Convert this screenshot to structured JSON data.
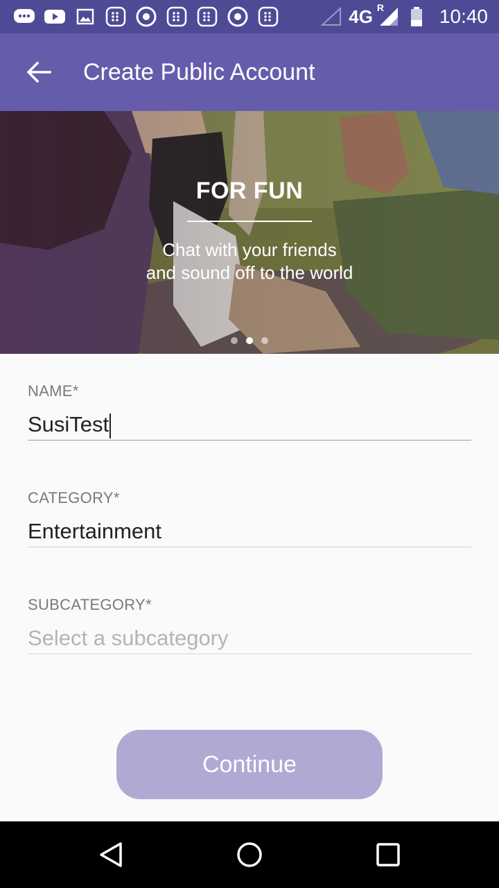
{
  "status_bar": {
    "network": "4G",
    "roaming": "R",
    "time": "10:40",
    "icons": [
      "messages-icon",
      "youtube-icon",
      "gallery-icon",
      "app-grid-icon",
      "chrome-icon",
      "app-grid-icon",
      "app-grid-icon",
      "chrome-icon",
      "app-grid-icon",
      "signal-icon",
      "battery-icon"
    ]
  },
  "app_bar": {
    "title": "Create Public Account",
    "back_icon": "arrow-back-icon"
  },
  "banner": {
    "title": "FOR FUN",
    "subtitle_line1": "Chat with your friends",
    "subtitle_line2": "and sound off to the world",
    "page_count": 3,
    "active_page": 2
  },
  "form": {
    "name": {
      "label": "NAME*",
      "value": "SusiTest"
    },
    "category": {
      "label": "CATEGORY*",
      "value": "Entertainment"
    },
    "subcategory": {
      "label": "SUBCATEGORY*",
      "placeholder": "Select a subcategory"
    }
  },
  "continue_label": "Continue",
  "colors": {
    "status_bar": "#4f4a96",
    "app_bar": "#665cac",
    "button_disabled": "#aeaad3"
  },
  "nav_bar": {
    "icons": [
      "back-triangle-icon",
      "home-circle-icon",
      "recents-square-icon"
    ]
  }
}
